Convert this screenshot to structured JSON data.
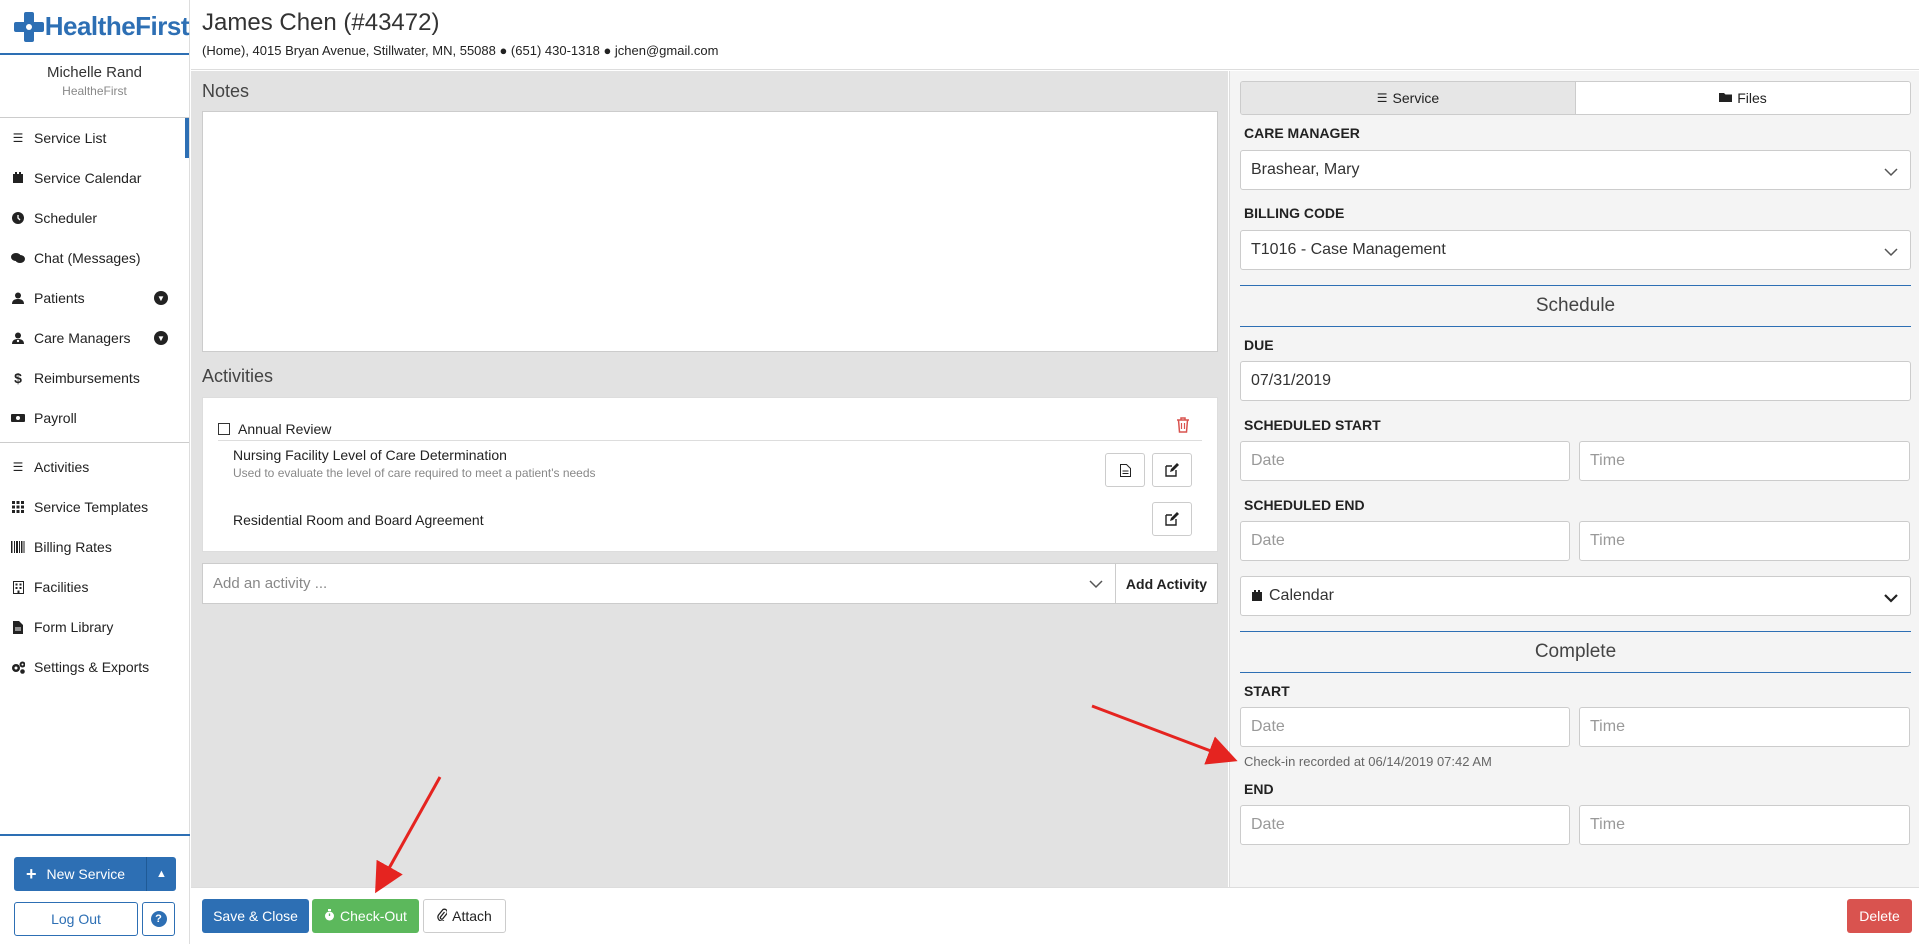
{
  "brand": {
    "logo_text": "HealtheFirst"
  },
  "user": {
    "name": "Michelle Rand",
    "org": "HealtheFirst"
  },
  "sidebar": {
    "items": [
      {
        "label": "Service List",
        "icon": "list-icon"
      },
      {
        "label": "Service Calendar",
        "icon": "calendar-icon"
      },
      {
        "label": "Scheduler",
        "icon": "clock-icon"
      },
      {
        "label": "Chat (Messages)",
        "icon": "chat-icon"
      },
      {
        "label": "Patients",
        "icon": "user-icon"
      },
      {
        "label": "Care Managers",
        "icon": "user-md-icon"
      },
      {
        "label": "Reimbursements",
        "icon": "dollar-icon"
      },
      {
        "label": "Payroll",
        "icon": "money-icon"
      },
      {
        "label": "Activities",
        "icon": "list-check-icon"
      },
      {
        "label": "Service Templates",
        "icon": "grid-icon"
      },
      {
        "label": "Billing Rates",
        "icon": "barcode-icon"
      },
      {
        "label": "Facilities",
        "icon": "building-icon"
      },
      {
        "label": "Form Library",
        "icon": "file-icon"
      },
      {
        "label": "Settings & Exports",
        "icon": "cogs-icon"
      }
    ],
    "new_service": "New Service",
    "logout": "Log Out",
    "help": "?"
  },
  "header": {
    "title": "James Chen (#43472)",
    "subtitle": "(Home), 4015 Bryan Avenue, Stillwater, MN, 55088 ● (651) 430-1318 ● jchen@gmail.com"
  },
  "main": {
    "notes_label": "Notes",
    "notes_value": "",
    "activities_label": "Activities",
    "activity_group": "Annual Review",
    "activity_items": [
      {
        "title": "Nursing Facility Level of Care Determination",
        "desc": "Used to evaluate the level of care required to meet a patient's needs"
      },
      {
        "title": "Residential Room and Board Agreement",
        "desc": ""
      }
    ],
    "add_activity_placeholder": "Add an activity ...",
    "add_activity_button": "Add Activity"
  },
  "right": {
    "tabs": [
      {
        "label": "Service"
      },
      {
        "label": "Files"
      }
    ],
    "care_manager_label": "CARE MANAGER",
    "care_manager_value": "Brashear, Mary",
    "billing_code_label": "BILLING CODE",
    "billing_code_value": "T1016 - Case Management",
    "schedule_title": "Schedule",
    "due_label": "DUE",
    "due_value": "07/31/2019",
    "scheduled_start_label": "SCHEDULED START",
    "scheduled_end_label": "SCHEDULED END",
    "date_placeholder": "Date",
    "time_placeholder": "Time",
    "calendar_label": "Calendar",
    "complete_title": "Complete",
    "start_label": "START",
    "checkin_note": "Check-in recorded at 06/14/2019 07:42 AM",
    "end_label": "END"
  },
  "footer": {
    "save_close": "Save & Close",
    "check_out": "Check-Out",
    "attach": "Attach",
    "delete": "Delete"
  },
  "colors": {
    "primary": "#2d6fb4",
    "success": "#5cb85c",
    "danger": "#d9534f",
    "annotation": "#e52420"
  }
}
